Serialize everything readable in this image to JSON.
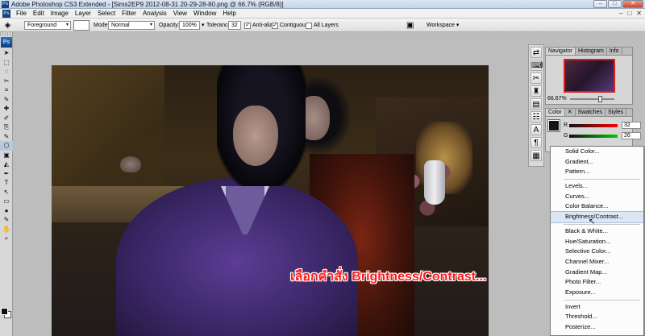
{
  "window": {
    "app_icon": "Ps",
    "title": "Adobe Photoshop CS3 Extended - [Sims2EP9 2012-08-31 20-29-28-80.png @ 66.7% (RGB/8)]",
    "minimize": "–",
    "maximize": "□",
    "close": "✕"
  },
  "menu": {
    "app_icon": "Ps",
    "items": [
      "File",
      "Edit",
      "Image",
      "Layer",
      "Select",
      "Filter",
      "Analysis",
      "View",
      "Window",
      "Help"
    ],
    "doc_minimize": "–",
    "doc_restore": "□",
    "doc_close": "✕"
  },
  "options": {
    "tool_glyph": "◈",
    "fill_source": "Foreground",
    "mode_label": "Mode:",
    "mode_value": "Normal",
    "opacity_label": "Opacity:",
    "opacity_value": "100%",
    "tolerance_label": "Tolerance:",
    "tolerance_value": "32",
    "antialias_label": "Anti-alias",
    "contiguous_label": "Contiguous",
    "all_layers_label": "All Layers",
    "check_mark": "✓",
    "dropdown_arrow": "▾",
    "workspace_label": "Workspace ▾",
    "workspace_glyph": "▣"
  },
  "tools": {
    "logo": "Ps",
    "glyphs": [
      "➤",
      "⬚",
      "◌",
      "✂",
      "⌗",
      "✎",
      "✚",
      "✐",
      "⎘",
      "✎",
      "⬡",
      "▣",
      "◭",
      "●",
      "✒",
      "T",
      "↖",
      "▭",
      "✋",
      "⌕"
    ]
  },
  "navigator": {
    "tabs": [
      "Navigator",
      "Histogram",
      "Info"
    ],
    "close_glyph": "✕",
    "zoom": "66.67%",
    "zoom_fraction": 0.6667
  },
  "color_panel": {
    "tabs": [
      "Color",
      "Swatches",
      "Styles"
    ],
    "close_glyph": "✕",
    "r_label": "R",
    "r_value": "32",
    "g_label": "G",
    "g_value": "26",
    "fg_color": "#141414"
  },
  "adjust_menu": {
    "items": [
      {
        "label": "Solid Color...",
        "sep_after": false
      },
      {
        "label": "Gradient...",
        "sep_after": false
      },
      {
        "label": "Pattern...",
        "sep_after": true
      },
      {
        "label": "Levels...",
        "sep_after": false
      },
      {
        "label": "Curves...",
        "sep_after": false
      },
      {
        "label": "Color Balance...",
        "sep_after": false
      },
      {
        "label": "Brightness/Contrast...",
        "sep_after": true,
        "highlighted": true
      },
      {
        "label": "Black & White...",
        "sep_after": false
      },
      {
        "label": "Hue/Saturation...",
        "sep_after": false
      },
      {
        "label": "Selective Color...",
        "sep_after": false
      },
      {
        "label": "Channel Mixer...",
        "sep_after": false
      },
      {
        "label": "Gradient Map...",
        "sep_after": false
      },
      {
        "label": "Photo Filter...",
        "sep_after": false
      },
      {
        "label": "Exposure...",
        "sep_after": true
      },
      {
        "label": "Invert",
        "sep_after": false
      },
      {
        "label": "Threshold...",
        "sep_after": false
      },
      {
        "label": "Posterize...",
        "sep_after": false
      }
    ]
  },
  "caption": "เลือกคำสั่ง Brightness/Contrast...",
  "right_strip_icons": [
    "⇄",
    "⌨",
    "✂",
    "♜",
    "▤",
    "☷",
    "A",
    "¶",
    "▦"
  ],
  "cursor_glyph": "↖"
}
